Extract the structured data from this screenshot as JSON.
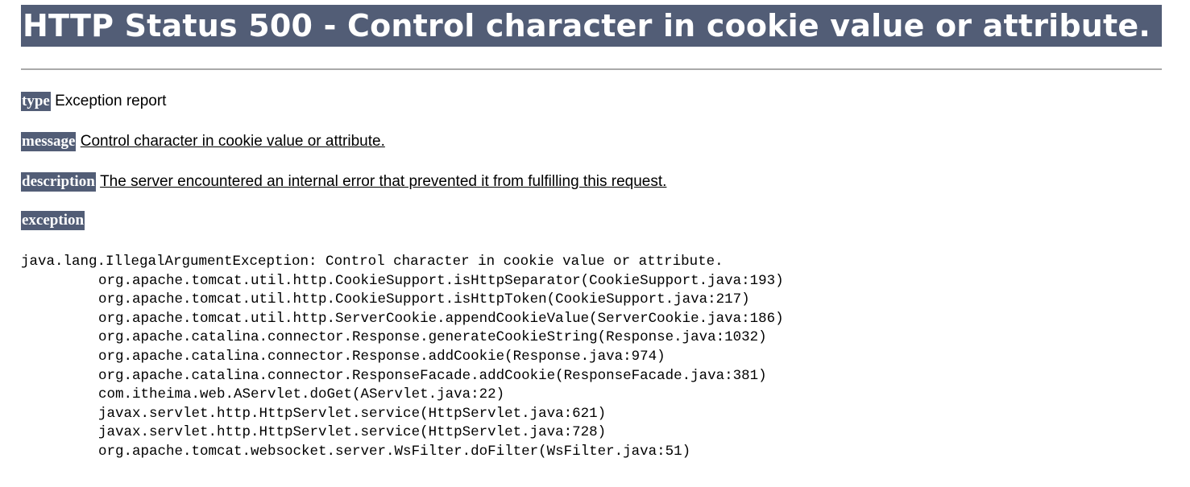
{
  "title": "HTTP Status 500 - Control character in cookie value or attribute.",
  "fields": {
    "type": {
      "label": "type",
      "value": "Exception report"
    },
    "message": {
      "label": "message",
      "value": "Control character in cookie value or attribute."
    },
    "description": {
      "label": "description",
      "value": "The server encountered an internal error that prevented it from fulfilling this request."
    },
    "exception": {
      "label": "exception"
    }
  },
  "stack_trace": {
    "header": "java.lang.IllegalArgumentException: Control character in cookie value or attribute.",
    "frames": [
      "org.apache.tomcat.util.http.CookieSupport.isHttpSeparator(CookieSupport.java:193)",
      "org.apache.tomcat.util.http.CookieSupport.isHttpToken(CookieSupport.java:217)",
      "org.apache.tomcat.util.http.ServerCookie.appendCookieValue(ServerCookie.java:186)",
      "org.apache.catalina.connector.Response.generateCookieString(Response.java:1032)",
      "org.apache.catalina.connector.Response.addCookie(Response.java:974)",
      "org.apache.catalina.connector.ResponseFacade.addCookie(ResponseFacade.java:381)",
      "com.itheima.web.AServlet.doGet(AServlet.java:22)",
      "javax.servlet.http.HttpServlet.service(HttpServlet.java:621)",
      "javax.servlet.http.HttpServlet.service(HttpServlet.java:728)",
      "org.apache.tomcat.websocket.server.WsFilter.doFilter(WsFilter.java:51)"
    ]
  },
  "colors": {
    "header_background": "#525d76",
    "header_text": "#ffffff",
    "rule": "#a9a9a9"
  }
}
